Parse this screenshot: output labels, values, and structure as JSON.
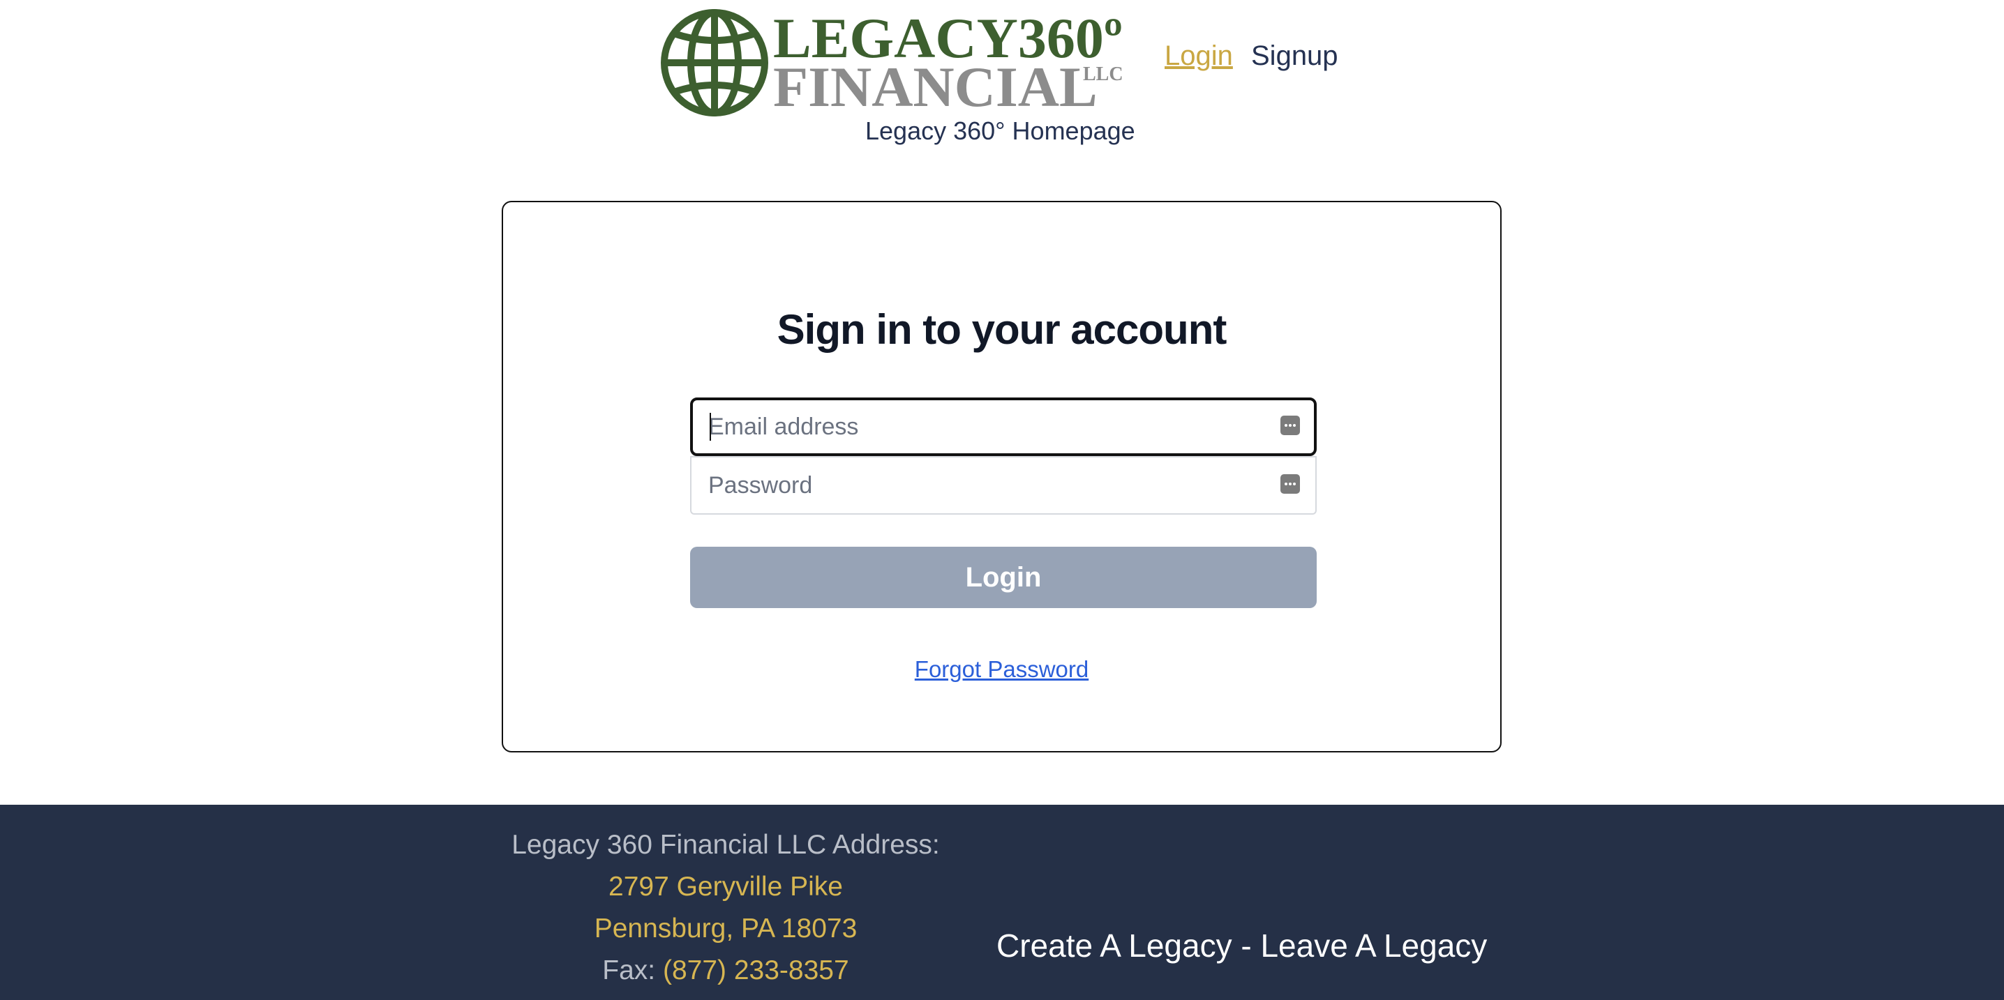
{
  "header": {
    "logo": {
      "line1": "LEGACY360º",
      "line2": "FINANCIAL",
      "suffix": "LLC",
      "primary_color": "#3d5f2f",
      "secondary_color": "#8c8c8c"
    },
    "nav": {
      "login_label": "Login",
      "signup_label": "Signup",
      "active": "Login"
    },
    "homepage_link": "Legacy 360° Homepage"
  },
  "login_card": {
    "title": "Sign in to your account",
    "email": {
      "placeholder": "Email address",
      "value": "",
      "focused": true,
      "icon": "password-manager-icon"
    },
    "password": {
      "placeholder": "Password",
      "value": "",
      "icon": "password-manager-icon"
    },
    "submit_label": "Login",
    "forgot_password_label": "Forgot Password"
  },
  "footer": {
    "address_label": "Legacy 360 Financial LLC Address:",
    "street": "2797 Geryville Pike",
    "city_state_zip": "Pennsburg, PA 18073",
    "fax_label": "Fax:",
    "fax_number": "(877) 233-8357",
    "tagline": "Create A Legacy - Leave A Legacy"
  },
  "colors": {
    "navy": "#253047",
    "gold": "#d7b652",
    "button_disabled": "#97a3b6",
    "link_blue": "#2b5fd9"
  }
}
